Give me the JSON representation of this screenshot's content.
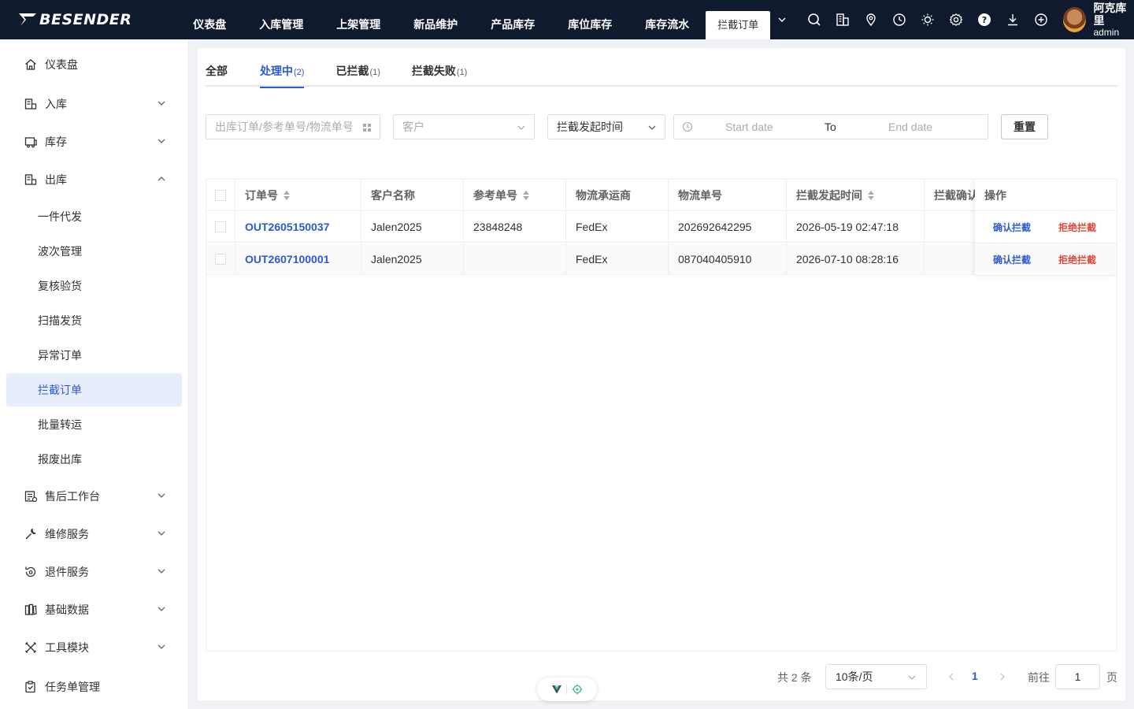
{
  "brand": {
    "name": "BESENDER"
  },
  "topnav": {
    "items": [
      "仪表盘",
      "入库管理",
      "上架管理",
      "新品维护",
      "产品库存",
      "库位库存",
      "库存流水"
    ],
    "active": "拦截订单"
  },
  "tools": [
    "search-icon",
    "building-icon",
    "location-icon",
    "clock-icon",
    "sun-icon",
    "gear-icon",
    "help-icon",
    "download-icon",
    "plus-circle-icon"
  ],
  "user": {
    "name": "阿克库里",
    "role": "admin"
  },
  "sidebar": {
    "items": [
      {
        "label": "仪表盘",
        "icon": "home-icon"
      },
      {
        "label": "入库",
        "icon": "inbound-icon"
      },
      {
        "label": "库存",
        "icon": "inventory-icon"
      },
      {
        "label": "出库",
        "icon": "outbound-icon"
      },
      {
        "label": "一件代发"
      },
      {
        "label": "波次管理"
      },
      {
        "label": "复核验货"
      },
      {
        "label": "扫描发货"
      },
      {
        "label": "异常订单"
      },
      {
        "label": "拦截订单"
      },
      {
        "label": "批量转运"
      },
      {
        "label": "报废出库"
      },
      {
        "label": "售后工作台",
        "icon": "aftersales-icon"
      },
      {
        "label": "维修服务",
        "icon": "wrench-icon"
      },
      {
        "label": "退件服务",
        "icon": "return-icon"
      },
      {
        "label": "基础数据",
        "icon": "data-icon"
      },
      {
        "label": "工具模块",
        "icon": "tools-icon"
      },
      {
        "label": "任务单管理",
        "icon": "task-icon"
      }
    ]
  },
  "tabs": [
    {
      "label": "全部",
      "count": ""
    },
    {
      "label": "处理中",
      "count": "(2)"
    },
    {
      "label": "已拦截",
      "count": "(1)"
    },
    {
      "label": "拦截失败",
      "count": "(1)"
    }
  ],
  "filters": {
    "search_placeholder": "出库订单/参考单号/物流单号",
    "customer_placeholder": "客户",
    "time_type": "拦截发起时间",
    "start_placeholder": "Start date",
    "range_separator": "To",
    "end_placeholder": "End date",
    "reset_label": "重置"
  },
  "table": {
    "columns": [
      "订单号",
      "客户名称",
      "参考单号",
      "物流承运商",
      "物流单号",
      "拦截发起时间",
      "拦截确认",
      "操作"
    ],
    "rows": [
      {
        "order_no": "OUT2605150037",
        "customer": "Jalen2025",
        "ref_no": "23848248",
        "carrier": "FedEx",
        "tracking_no": "202692642295",
        "initiated_at": "2026-05-19 02:47:18",
        "confirmed": ""
      },
      {
        "order_no": "OUT2607100001",
        "customer": "Jalen2025",
        "ref_no": "",
        "carrier": "FedEx",
        "tracking_no": "087040405910",
        "initiated_at": "2026-07-10 08:28:16",
        "confirmed": ""
      }
    ],
    "actions": {
      "confirm": "确认拦截",
      "reject": "拒绝拦截"
    }
  },
  "pagination": {
    "total": "共 2 条",
    "page_size": "10条/页",
    "current_page": "1",
    "goto_label": "前往",
    "goto_value": "1",
    "page_unit": "页"
  },
  "colors": {
    "header_bg": "#0f1a2e",
    "accent": "#2c5ad6",
    "danger": "#e0463c"
  }
}
